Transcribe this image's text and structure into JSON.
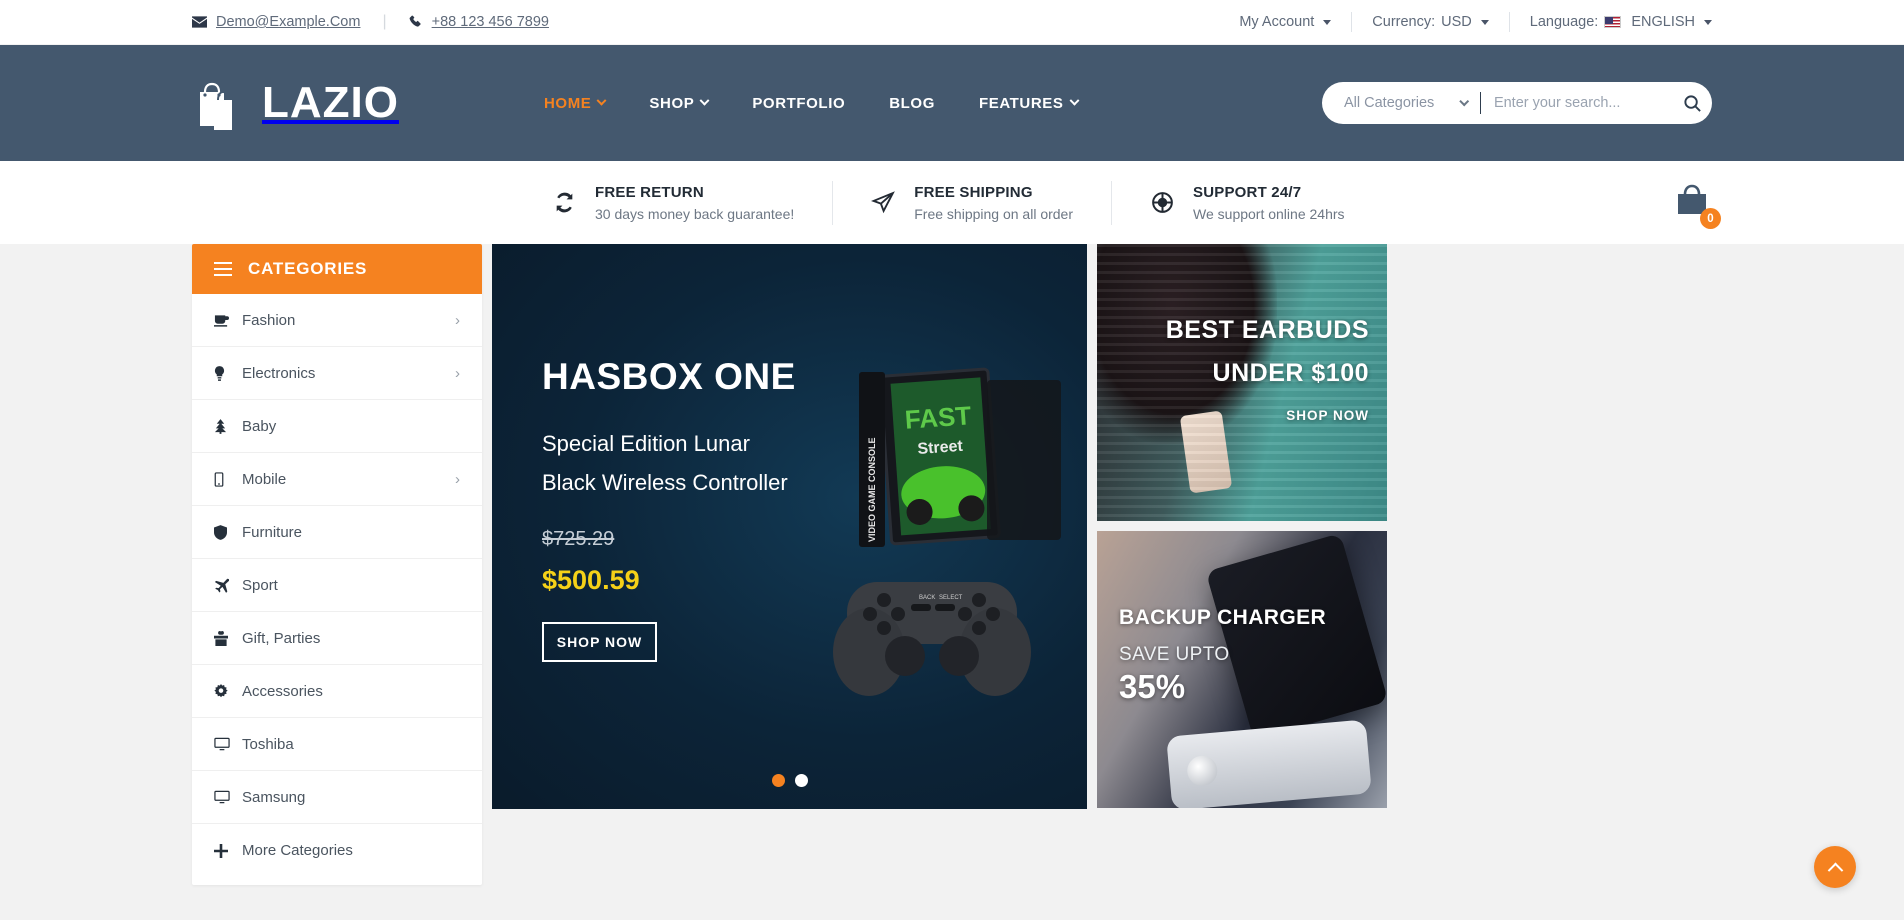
{
  "topbar": {
    "email": "Demo@Example.Com",
    "phone": "+88 123 456 7899",
    "account": "My Account",
    "currency_label": "Currency:",
    "currency_value": "USD",
    "language_label": "Language:",
    "language_value": "ENGLISH"
  },
  "header": {
    "logo": "LAZIO",
    "nav": [
      {
        "label": "HOME",
        "caret": true,
        "active": true
      },
      {
        "label": "SHOP",
        "caret": true,
        "active": false
      },
      {
        "label": "PORTFOLIO",
        "caret": false,
        "active": false
      },
      {
        "label": "BLOG",
        "caret": false,
        "active": false
      },
      {
        "label": "FEATURES",
        "caret": true,
        "active": false
      }
    ],
    "search": {
      "category": "All Categories",
      "placeholder": "Enter your search...",
      "value": ""
    }
  },
  "services": [
    {
      "title": "FREE RETURN",
      "sub": "30 days money back guarantee!",
      "icon": "refresh-icon"
    },
    {
      "title": "FREE SHIPPING",
      "sub": "Free shipping on all order",
      "icon": "paper-plane-icon"
    },
    {
      "title": "SUPPORT 24/7",
      "sub": "We support online 24hrs",
      "icon": "lifebuoy-icon"
    }
  ],
  "cart": {
    "count": "0"
  },
  "sidebar": {
    "title": "CATEGORIES",
    "items": [
      {
        "label": "Fashion",
        "icon": "mug-icon",
        "arrow": true
      },
      {
        "label": "Electronics",
        "icon": "bulb-icon",
        "arrow": true
      },
      {
        "label": "Baby",
        "icon": "tree-icon",
        "arrow": false
      },
      {
        "label": "Mobile",
        "icon": "phone-icon",
        "arrow": true
      },
      {
        "label": "Furniture",
        "icon": "shield-icon",
        "arrow": false
      },
      {
        "label": "Sport",
        "icon": "plane-icon",
        "arrow": false
      },
      {
        "label": "Gift, Parties",
        "icon": "gift-icon",
        "arrow": false
      },
      {
        "label": "Accessories",
        "icon": "gear-icon",
        "arrow": false
      },
      {
        "label": "Toshiba",
        "icon": "monitor-icon",
        "arrow": false
      },
      {
        "label": "Samsung",
        "icon": "monitor-icon",
        "arrow": false
      },
      {
        "label": "More Categories",
        "icon": "plus-icon",
        "arrow": false
      }
    ]
  },
  "hero": {
    "title": "HASBOX ONE",
    "sub_line1": "Special Edition Lunar",
    "sub_line2": "Black Wireless Controller",
    "old_price": "$725.29",
    "new_price": "$500.59",
    "cta": "SHOP NOW",
    "slide_count": 2,
    "active_slide": 1
  },
  "promos": [
    {
      "line1": "BEST EARBUDS",
      "line2": "UNDER $100",
      "cta": "SHOP NOW"
    },
    {
      "line1": "BACKUP CHARGER",
      "line2": "SAVE UPTO",
      "line3": "35%"
    }
  ],
  "colors": {
    "accent": "#f58220",
    "header_bg": "#44586e",
    "hero_bg": "#0c2438",
    "price_highlight": "#f5d118"
  }
}
